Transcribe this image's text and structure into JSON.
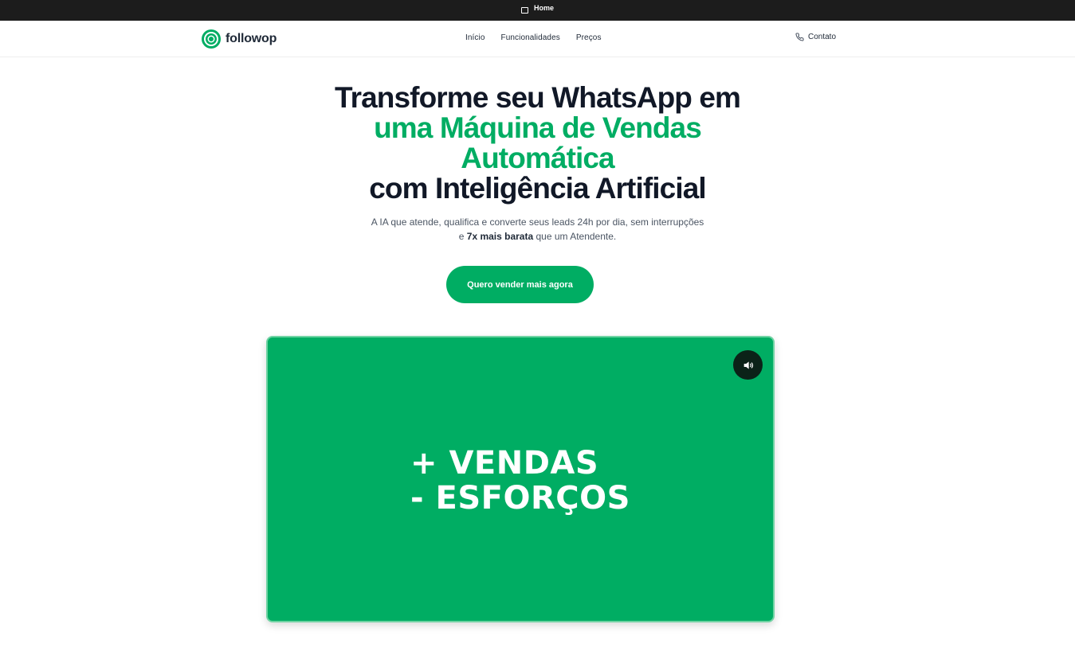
{
  "browser_tab": {
    "icon": "window-icon",
    "label": "Home"
  },
  "nav": {
    "logo_text": "followop",
    "links": [
      "Início",
      "Funcionalidades",
      "Preços"
    ],
    "contact_label": "Contato",
    "contact_icon": "phone-icon"
  },
  "hero": {
    "headline_line1": "Transforme seu WhatsApp em",
    "headline_line2": "uma Máquina de Vendas",
    "headline_line3": "Automática",
    "headline_line4": "com Inteligência Artificial",
    "subtitle_part1": "A IA que atende, qualifica e converte seus leads 24h por dia, sem interrupções e ",
    "subtitle_bold": "7x mais barata",
    "subtitle_part2": " que um Atendente.",
    "cta_label": "Quero vender mais agora"
  },
  "video": {
    "line1": "+ VENDAS",
    "line2": "- ESFORÇOS",
    "sound_icon": "volume-icon"
  },
  "colors": {
    "accent": "#00ad63",
    "topbar": "#1c1c1c",
    "text_dark": "#111827"
  }
}
